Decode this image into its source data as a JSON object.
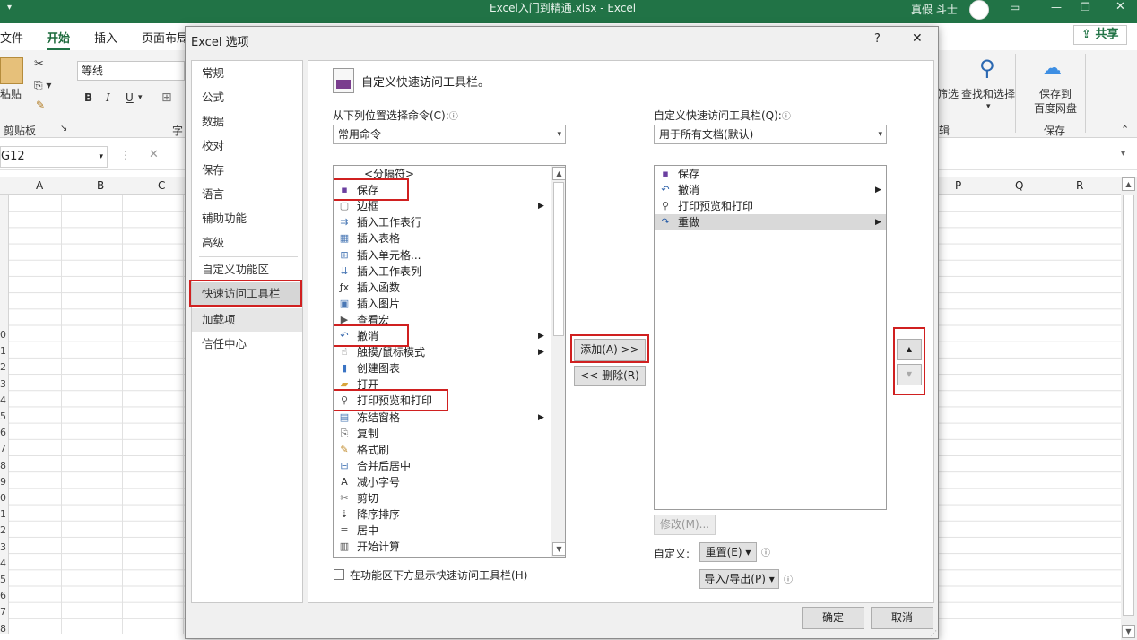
{
  "window": {
    "title": "Excel入门到精通.xlsx  -  Excel",
    "user": "真假 斗士"
  },
  "ribbon": {
    "tabs": [
      "文件",
      "开始",
      "插入",
      "页面布局"
    ],
    "share_label": "共享",
    "paste_label": "粘贴",
    "clipboard_group": "剪贴板",
    "font_name": "等线",
    "font_group_partial": "字",
    "bold": "B",
    "italic": "I",
    "underline": "U",
    "filter_label": "筛选",
    "find_label": "查找和选择",
    "edit_group_partial": "辑",
    "baidu_label_1": "保存到",
    "baidu_label_2": "百度网盘",
    "save_group": "保存"
  },
  "formula_bar": {
    "name_box": "G12"
  },
  "sheet": {
    "columns_left": [
      "A",
      "B",
      "C"
    ],
    "columns_right": [
      "P",
      "Q",
      "R"
    ],
    "row_numbers": [
      "0",
      "1",
      "2",
      "3",
      "4",
      "5",
      "6",
      "7",
      "8",
      "9",
      "0",
      "1",
      "2",
      "3",
      "4",
      "5",
      "6",
      "7",
      "8"
    ]
  },
  "dialog": {
    "title": "Excel 选项",
    "help": "?",
    "close": "✕",
    "nav": [
      "常规",
      "公式",
      "数据",
      "校对",
      "保存",
      "语言",
      "辅助功能",
      "高级",
      "自定义功能区",
      "快速访问工具栏",
      "加载项",
      "信任中心"
    ],
    "heading": "自定义快速访问工具栏。",
    "choose_label": "从下列位置选择命令(C):",
    "choose_value": "常用命令",
    "customize_label": "自定义快速访问工具栏(Q):",
    "customize_value": "用于所有文档(默认)",
    "info_icon": "ⓘ",
    "commands": [
      {
        "label": "<分隔符>",
        "icon": ""
      },
      {
        "label": "保存",
        "icon": "save-icon"
      },
      {
        "label": "边框",
        "icon": "border-icon"
      },
      {
        "label": "插入工作表行",
        "icon": "insert-row-icon"
      },
      {
        "label": "插入表格",
        "icon": "insert-table-icon"
      },
      {
        "label": "插入单元格...",
        "icon": "insert-cell-icon"
      },
      {
        "label": "插入工作表列",
        "icon": "insert-column-icon"
      },
      {
        "label": "插入函数",
        "icon": "function-icon"
      },
      {
        "label": "插入图片",
        "icon": "picture-icon"
      },
      {
        "label": "查看宏",
        "icon": "macro-icon"
      },
      {
        "label": "撤消",
        "icon": "undo-icon"
      },
      {
        "label": "触摸/鼠标模式",
        "icon": "touch-icon"
      },
      {
        "label": "创建图表",
        "icon": "chart-icon"
      },
      {
        "label": "打开",
        "icon": "open-icon"
      },
      {
        "label": "打印预览和打印",
        "icon": "print-preview-icon"
      },
      {
        "label": "冻结窗格",
        "icon": "freeze-icon"
      },
      {
        "label": "复制",
        "icon": "copy-icon"
      },
      {
        "label": "格式刷",
        "icon": "format-painter-icon"
      },
      {
        "label": "合并后居中",
        "icon": "merge-icon"
      },
      {
        "label": "减小字号",
        "icon": "decrease-font-icon"
      },
      {
        "label": "剪切",
        "icon": "cut-icon"
      },
      {
        "label": "降序排序",
        "icon": "sort-desc-icon"
      },
      {
        "label": "居中",
        "icon": "center-icon"
      },
      {
        "label": "开始计算",
        "icon": "calculate-icon"
      }
    ],
    "qat_items": [
      {
        "label": "保存",
        "icon": "save-icon"
      },
      {
        "label": "撤消",
        "icon": "undo-icon"
      },
      {
        "label": "打印预览和打印",
        "icon": "print-preview-icon"
      },
      {
        "label": "重做",
        "icon": "redo-icon",
        "selected": true
      }
    ],
    "add_button": "添加(A) >>",
    "remove_button": "<< 删除(R)",
    "modify_button": "修改(M)...",
    "customize_footer": "自定义:",
    "reset_button": "重置(E) ▾",
    "import_export_button": "导入/导出(P) ▾",
    "show_below_ribbon": "在功能区下方显示快速访问工具栏(H)",
    "ok_button": "确定",
    "cancel_button": "取消"
  }
}
